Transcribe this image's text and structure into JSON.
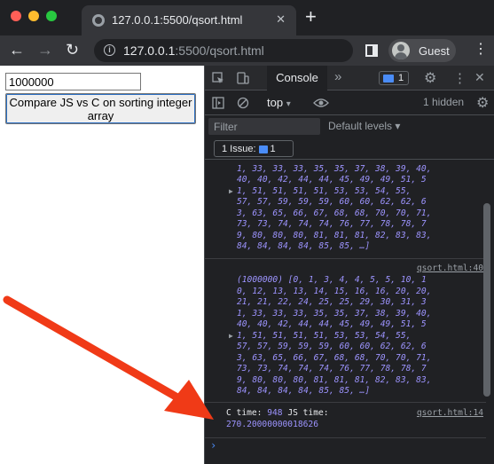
{
  "browser": {
    "tab_title": "127.0.0.1:5500/qsort.html",
    "tab_close": "✕",
    "new_tab": "+",
    "url_host": "127.0.0.1",
    "url_rest": ":5500/qsort.html",
    "profile": "Guest",
    "menu": "⋮"
  },
  "page": {
    "input_value": "1000000",
    "button_label": "Compare JS vs C on sorting integer array"
  },
  "devtools": {
    "console_tab": "Console",
    "more_tabs": "»",
    "message_count": "1",
    "context": "top",
    "hidden": "1 hidden",
    "filter_placeholder": "Filter",
    "levels": "Default levels ▾",
    "issues_label": "1 Issue:",
    "issues_count": "1",
    "entries": [
      {
        "lines": [
          "1, 33, 33, 33, 35, 35, 37, 38, 39, 40,",
          "40, 40, 42, 44, 44, 45, 49, 49, 51, 5",
          "1, 51, 51, 51, 51, 53, 53, 54, 55,",
          "57, 57, 59, 59, 59, 60, 60, 62, 62, 6",
          "3, 63, 65, 66, 67, 68, 68, 70, 70, 71,",
          "73, 73, 74, 74, 74, 76, 77, 78, 78, 7",
          "9, 80, 80, 80, 81, 81, 81, 82, 83, 83,",
          "84, 84, 84, 84, 85, 85, …]"
        ]
      },
      {
        "source": "qsort.html:40",
        "length": "(1000000)",
        "lines": [
          "[0, 1, 3, 4, 4, 5, 5, 10, 1",
          "0, 12, 13, 13, 14, 15, 16, 16, 20, 20,",
          "21, 21, 22, 24, 25, 25, 29, 30, 31, 3",
          "1, 33, 33, 33, 35, 35, 37, 38, 39, 40,",
          "40, 40, 42, 44, 44, 45, 49, 49, 51, 5",
          "1, 51, 51, 51, 51, 53, 53, 54, 55,",
          "57, 57, 59, 59, 59, 60, 60, 62, 62, 6",
          "3, 63, 65, 66, 67, 68, 68, 70, 70, 71,",
          "73, 73, 74, 74, 74, 76, 77, 78, 78, 7",
          "9, 80, 80, 80, 81, 81, 81, 82, 83, 83,",
          "84, 84, 84, 84, 85, 85, …]"
        ]
      }
    ],
    "timing": {
      "source": "qsort.html:14",
      "c_label": "C time: ",
      "c_value": "948",
      "js_label": " JS time:",
      "js_value": "270.20000000018626"
    },
    "prompt": "›"
  },
  "colors": {
    "arrow": "#f03a17",
    "array_text": "#9d94ff",
    "accent_blue": "#4a8cf7"
  },
  "icons": [
    "info-icon",
    "back-arrow-icon",
    "forward-arrow-icon",
    "reload-icon",
    "sidepanel-icon",
    "avatar-icon",
    "inspect-icon",
    "device-toolbar-icon",
    "settings-gear-icon",
    "close-icon",
    "sidebar-toggle-icon",
    "clear-console-icon",
    "eye-icon",
    "message-icon",
    "red-arrow-annotation"
  ]
}
